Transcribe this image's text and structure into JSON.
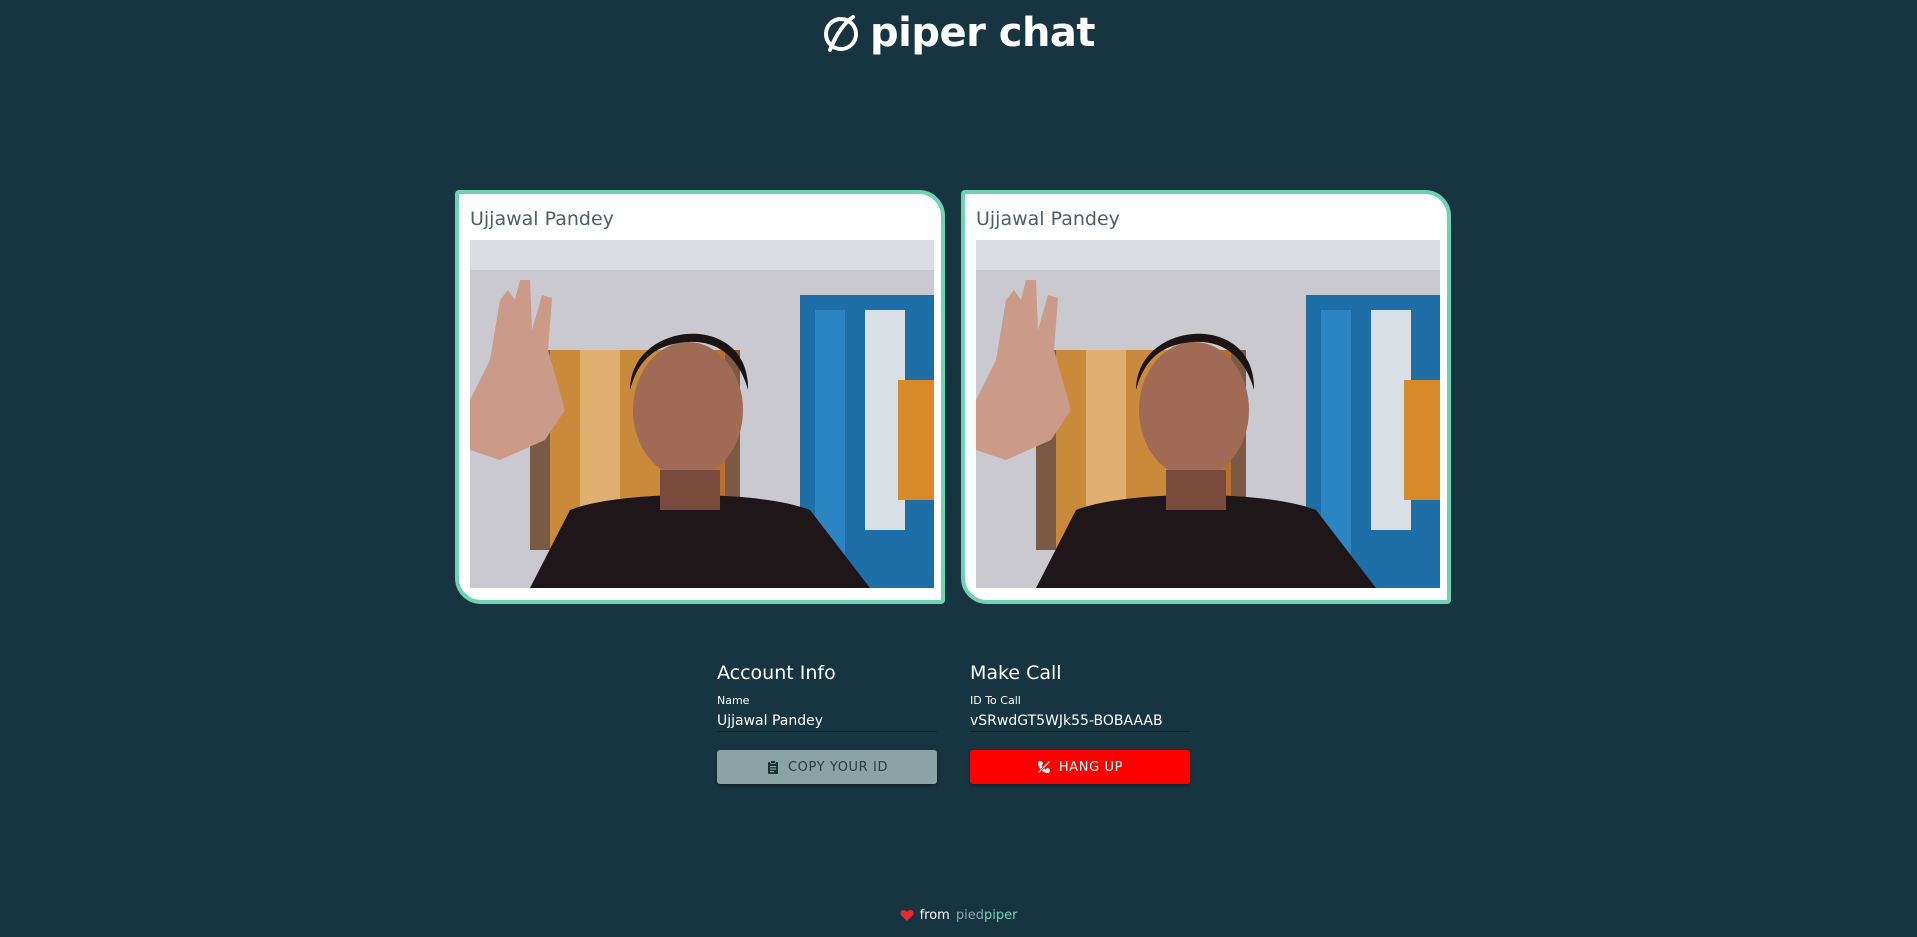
{
  "app": {
    "title": "piper chat",
    "logo_icon": "piper-logo-icon"
  },
  "videos": [
    {
      "name": "Ujjawal Pandey"
    },
    {
      "name": "Ujjawal Pandey"
    }
  ],
  "account": {
    "heading": "Account Info",
    "name_label": "Name",
    "name_value": "Ujjawal Pandey",
    "copy_button_label": "COPY YOUR ID",
    "copy_icon": "clipboard-icon"
  },
  "call": {
    "heading": "Make Call",
    "id_label": "ID To Call",
    "id_value": "vSRwdGT5WJk55-BOBAAAB",
    "hangup_button_label": "HANG UP",
    "hangup_icon": "phone-disabled-icon"
  },
  "footer": {
    "from_text": "from",
    "brand_part1": "pied",
    "brand_part2": "piper",
    "heart_icon": "heart-icon"
  },
  "colors": {
    "background": "#163540",
    "accent": "#6ed3b2",
    "hangup": "#ff0000",
    "copy_button": "#8aa3a4"
  }
}
